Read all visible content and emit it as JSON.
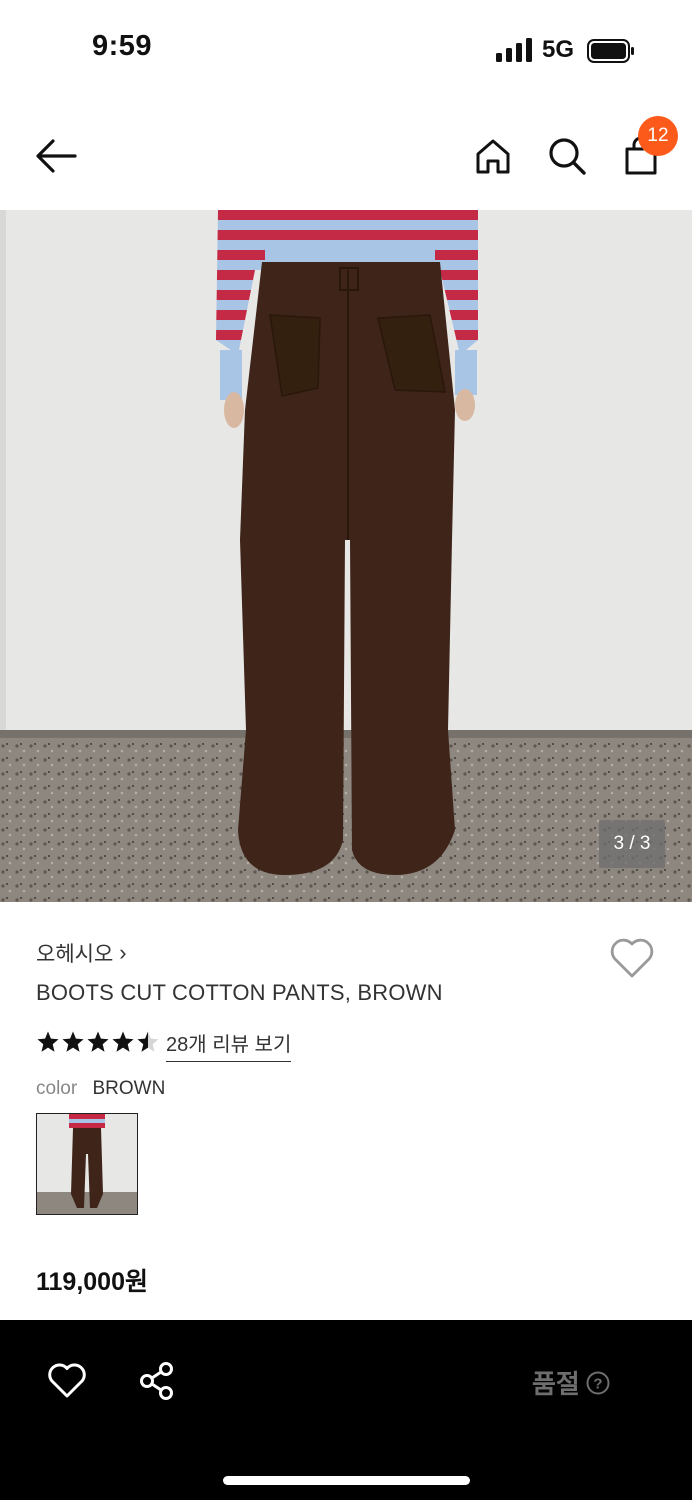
{
  "status": {
    "time": "9:59",
    "network": "5G"
  },
  "header": {
    "cart_count": "12",
    "back_icon": "arrow-left-icon",
    "home_icon": "home-icon",
    "search_icon": "search-icon",
    "bag_icon": "shopping-bag-icon"
  },
  "gallery": {
    "counter": "3 / 3"
  },
  "product": {
    "brand": "오헤시오",
    "brand_chevron": "›",
    "name": "BOOTS CUT COTTON PANTS, BROWN",
    "rating": 4.5,
    "rating_max": 5,
    "review_link": "28개 리뷰 보기",
    "color_label": "color",
    "color_value": "BROWN",
    "price": "119,000원"
  },
  "bottom_bar": {
    "soldout_label": "품절",
    "help_icon": "question-circle-icon"
  },
  "colors": {
    "badge": "#fb5a1a",
    "pants": "#3e2419",
    "star": "#111111"
  }
}
